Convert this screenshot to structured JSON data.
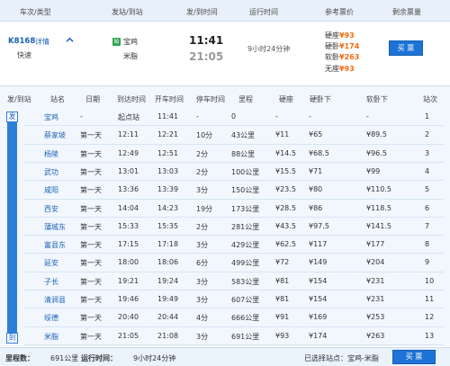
{
  "header": {
    "col_train_type": "车次/类型",
    "col_stations": "发站/到站",
    "col_times": "发/到时间",
    "col_duration": "运行时间",
    "col_price": "参考票价",
    "col_remaining": "剩余票量"
  },
  "train": {
    "number": "K8168",
    "detail_link": "详情",
    "type": "快速",
    "from_icon": "始",
    "from": "宝鸡",
    "to": "米脂",
    "depart": "11:41",
    "arrive": "21:05",
    "duration": "9小时24分钟",
    "prices": [
      {
        "label": "硬座",
        "price": "¥93"
      },
      {
        "label": "硬卧",
        "price": "¥174"
      },
      {
        "label": "软卧",
        "price": "¥263"
      },
      {
        "label": "无座",
        "price": "¥93"
      }
    ],
    "buy_label": "买 票"
  },
  "stops_header": {
    "dep_arr": "发/到站",
    "name": "站名",
    "day": "日期",
    "arrive": "到达时间",
    "depart": "开车时间",
    "stop": "停车时间",
    "distance": "里程",
    "hard_seat": "硬座",
    "hard_sleeper": "硬卧下",
    "soft_sleeper": "软卧下",
    "seq": "站次"
  },
  "stops": [
    {
      "name": "宝鸡",
      "day": "-",
      "arrive": "起点站",
      "depart": "11:41",
      "stop": "-",
      "distance": "0",
      "hard_seat": "-",
      "hard_sleeper": "-",
      "soft_sleeper": "-",
      "seq": "1"
    },
    {
      "name": "蔡家坡",
      "day": "第一天",
      "arrive": "12:11",
      "depart": "12:21",
      "stop": "10分",
      "distance": "43公里",
      "hard_seat": "¥11",
      "hard_sleeper": "¥65",
      "soft_sleeper": "¥89.5",
      "seq": "2"
    },
    {
      "name": "杨陵",
      "day": "第一天",
      "arrive": "12:49",
      "depart": "12:51",
      "stop": "2分",
      "distance": "88公里",
      "hard_seat": "¥14.5",
      "hard_sleeper": "¥68.5",
      "soft_sleeper": "¥96.5",
      "seq": "3"
    },
    {
      "name": "武功",
      "day": "第一天",
      "arrive": "13:01",
      "depart": "13:03",
      "stop": "2分",
      "distance": "100公里",
      "hard_seat": "¥15.5",
      "hard_sleeper": "¥71",
      "soft_sleeper": "¥99",
      "seq": "4"
    },
    {
      "name": "咸阳",
      "day": "第一天",
      "arrive": "13:36",
      "depart": "13:39",
      "stop": "3分",
      "distance": "150公里",
      "hard_seat": "¥23.5",
      "hard_sleeper": "¥80",
      "soft_sleeper": "¥110.5",
      "seq": "5"
    },
    {
      "name": "西安",
      "day": "第一天",
      "arrive": "14:04",
      "depart": "14:23",
      "stop": "19分",
      "distance": "173公里",
      "hard_seat": "¥28.5",
      "hard_sleeper": "¥86",
      "soft_sleeper": "¥118.5",
      "seq": "6"
    },
    {
      "name": "蒲城东",
      "day": "第一天",
      "arrive": "15:33",
      "depart": "15:35",
      "stop": "2分",
      "distance": "281公里",
      "hard_seat": "¥43.5",
      "hard_sleeper": "¥97.5",
      "soft_sleeper": "¥141.5",
      "seq": "7"
    },
    {
      "name": "富县东",
      "day": "第一天",
      "arrive": "17:15",
      "depart": "17:18",
      "stop": "3分",
      "distance": "429公里",
      "hard_seat": "¥62.5",
      "hard_sleeper": "¥117",
      "soft_sleeper": "¥177",
      "seq": "8"
    },
    {
      "name": "延安",
      "day": "第一天",
      "arrive": "18:00",
      "depart": "18:06",
      "stop": "6分",
      "distance": "499公里",
      "hard_seat": "¥72",
      "hard_sleeper": "¥149",
      "soft_sleeper": "¥204",
      "seq": "9"
    },
    {
      "name": "子长",
      "day": "第一天",
      "arrive": "19:21",
      "depart": "19:24",
      "stop": "3分",
      "distance": "583公里",
      "hard_seat": "¥81",
      "hard_sleeper": "¥154",
      "soft_sleeper": "¥231",
      "seq": "10"
    },
    {
      "name": "清涧县",
      "day": "第一天",
      "arrive": "19:46",
      "depart": "19:49",
      "stop": "3分",
      "distance": "607公里",
      "hard_seat": "¥81",
      "hard_sleeper": "¥154",
      "soft_sleeper": "¥231",
      "seq": "11"
    },
    {
      "name": "绥德",
      "day": "第一天",
      "arrive": "20:40",
      "depart": "20:44",
      "stop": "4分",
      "distance": "666公里",
      "hard_seat": "¥91",
      "hard_sleeper": "¥169",
      "soft_sleeper": "¥253",
      "seq": "12"
    },
    {
      "name": "米脂",
      "day": "第一天",
      "arrive": "21:05",
      "depart": "21:08",
      "stop": "3分",
      "distance": "691公里",
      "hard_seat": "¥93",
      "hard_sleeper": "¥174",
      "soft_sleeper": "¥263",
      "seq": "13"
    }
  ],
  "journey_bar": {
    "start": "发",
    "end": "到"
  },
  "footer": {
    "distance_label": "里程数：",
    "distance_value": "691公里",
    "time_label": "运行时间：",
    "time_value": "9小时24分钟",
    "selected_label": "已选择站点：宝鸡-米脂",
    "buy_label": "买 票"
  },
  "colors": {
    "accent": "#1d73d6",
    "price": "#f26a10",
    "header_bg": "#e8f1fb",
    "panel_bg": "#f2f7fd"
  }
}
